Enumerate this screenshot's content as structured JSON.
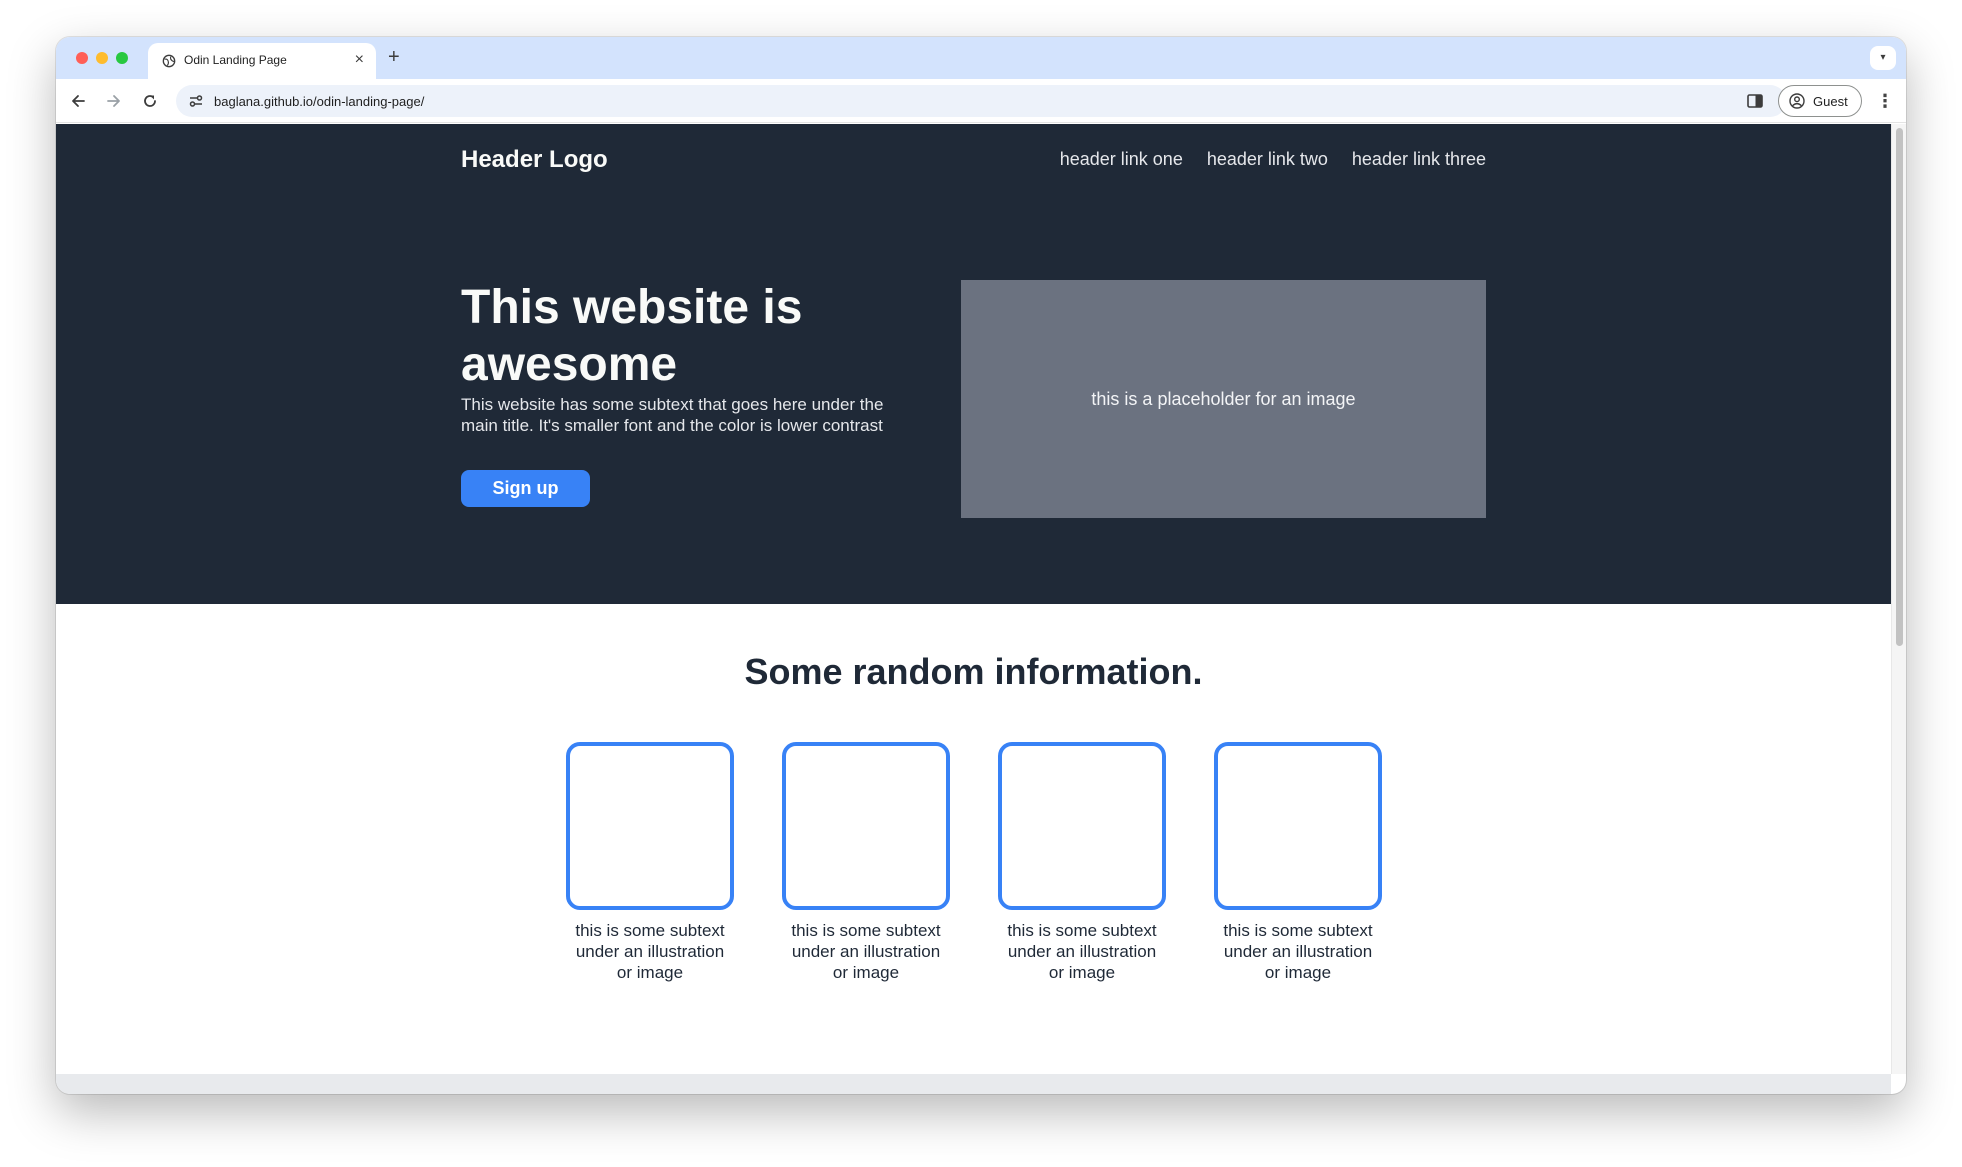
{
  "browser": {
    "tab_title": "Odin Landing Page",
    "tab_close": "×",
    "new_tab": "+",
    "url": "baglana.github.io/odin-landing-page/",
    "guest_label": "Guest",
    "menu_glyph": "⋮",
    "tab_dropdown_glyph": "▾",
    "icons": [
      "globe-icon",
      "back-icon",
      "forward-icon",
      "reload-icon",
      "site-settings-icon",
      "side-panel-icon",
      "person-icon",
      "kebab-menu-icon",
      "chevron-down-icon"
    ]
  },
  "header": {
    "logo": "Header Logo",
    "links": [
      "header link one",
      "header link two",
      "header link three"
    ]
  },
  "hero": {
    "title": "This website is awesome",
    "subtext": "This website has some subtext that goes here under the main title. It's smaller font and the color is lower contrast",
    "signup_label": "Sign up",
    "image_placeholder": "this is a placeholder for an image"
  },
  "info": {
    "heading": "Some random information.",
    "cards": [
      {
        "subtext": "this is some subtext under an illustration or image"
      },
      {
        "subtext": "this is some subtext under an illustration or image"
      },
      {
        "subtext": "this is some subtext under an illustration or image"
      },
      {
        "subtext": "this is some subtext under an illustration or image"
      }
    ]
  },
  "colors": {
    "hero_bg": "#1f2937",
    "accent": "#3882f6",
    "placeholder_bg": "#6b7280",
    "tabstrip_bg": "#d3e3fd"
  }
}
